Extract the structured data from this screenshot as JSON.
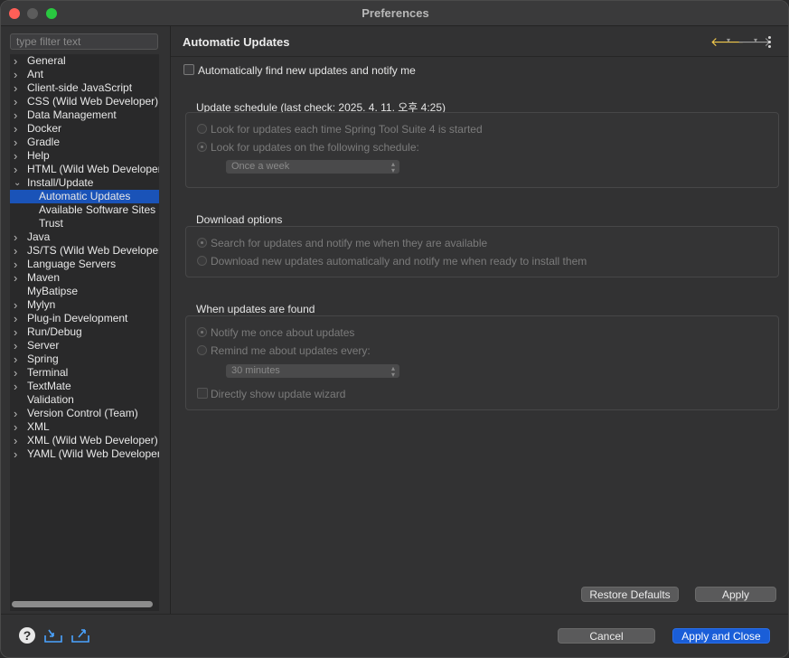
{
  "window": {
    "title": "Preferences"
  },
  "sidebar": {
    "filter_placeholder": "type filter text",
    "items": [
      {
        "label": "General",
        "expandable": true,
        "child": false,
        "selected": false
      },
      {
        "label": "Ant",
        "expandable": true,
        "child": false,
        "selected": false
      },
      {
        "label": "Client-side JavaScript",
        "expandable": true,
        "child": false,
        "selected": false
      },
      {
        "label": "CSS (Wild Web Developer)",
        "expandable": true,
        "child": false,
        "selected": false
      },
      {
        "label": "Data Management",
        "expandable": true,
        "child": false,
        "selected": false
      },
      {
        "label": "Docker",
        "expandable": true,
        "child": false,
        "selected": false
      },
      {
        "label": "Gradle",
        "expandable": true,
        "child": false,
        "selected": false
      },
      {
        "label": "Help",
        "expandable": true,
        "child": false,
        "selected": false
      },
      {
        "label": "HTML (Wild Web Developer)",
        "expandable": true,
        "child": false,
        "selected": false
      },
      {
        "label": "Install/Update",
        "expandable": true,
        "expanded": true,
        "child": false,
        "selected": false
      },
      {
        "label": "Automatic Updates",
        "expandable": false,
        "child": true,
        "selected": true
      },
      {
        "label": "Available Software Sites",
        "expandable": false,
        "child": true,
        "selected": false
      },
      {
        "label": "Trust",
        "expandable": false,
        "child": true,
        "selected": false
      },
      {
        "label": "Java",
        "expandable": true,
        "child": false,
        "selected": false
      },
      {
        "label": "JS/TS (Wild Web Developer)",
        "expandable": true,
        "child": false,
        "selected": false
      },
      {
        "label": "Language Servers",
        "expandable": true,
        "child": false,
        "selected": false
      },
      {
        "label": "Maven",
        "expandable": true,
        "child": false,
        "selected": false
      },
      {
        "label": "MyBatipse",
        "expandable": false,
        "child": false,
        "selected": false
      },
      {
        "label": "Mylyn",
        "expandable": true,
        "child": false,
        "selected": false
      },
      {
        "label": "Plug-in Development",
        "expandable": true,
        "child": false,
        "selected": false
      },
      {
        "label": "Run/Debug",
        "expandable": true,
        "child": false,
        "selected": false
      },
      {
        "label": "Server",
        "expandable": true,
        "child": false,
        "selected": false
      },
      {
        "label": "Spring",
        "expandable": true,
        "child": false,
        "selected": false
      },
      {
        "label": "Terminal",
        "expandable": true,
        "child": false,
        "selected": false
      },
      {
        "label": "TextMate",
        "expandable": true,
        "child": false,
        "selected": false
      },
      {
        "label": "Validation",
        "expandable": false,
        "child": false,
        "selected": false
      },
      {
        "label": "Version Control (Team)",
        "expandable": true,
        "child": false,
        "selected": false
      },
      {
        "label": "XML",
        "expandable": true,
        "child": false,
        "selected": false
      },
      {
        "label": "XML (Wild Web Developer)",
        "expandable": true,
        "child": false,
        "selected": false
      },
      {
        "label": "YAML (Wild Web Developer)",
        "expandable": true,
        "child": false,
        "selected": false
      }
    ]
  },
  "main": {
    "title": "Automatic Updates",
    "auto_find_label": "Automatically find new updates and notify me",
    "schedule": {
      "title": "Update schedule (last check: 2025. 4. 11. 오후 4:25)",
      "option_startup": "Look for updates each time Spring Tool Suite 4 is started",
      "option_schedule": "Look for updates on the following schedule:",
      "interval": "Once a week"
    },
    "download": {
      "title": "Download options",
      "option_notify": "Search for updates and notify me when they are available",
      "option_auto": "Download new updates automatically and notify me when ready to install them"
    },
    "found": {
      "title": "When updates are found",
      "option_once": "Notify me once about updates",
      "option_remind": "Remind me about updates every:",
      "remind_interval": "30 minutes",
      "show_wizard": "Directly show update wizard"
    },
    "restore_defaults": "Restore Defaults",
    "apply": "Apply"
  },
  "footer": {
    "help": "?",
    "cancel": "Cancel",
    "apply_close": "Apply and Close"
  },
  "colors": {
    "selection": "#1a53b8",
    "primary_button": "#1a5ed8",
    "back_arrow": "#f2c94c"
  }
}
